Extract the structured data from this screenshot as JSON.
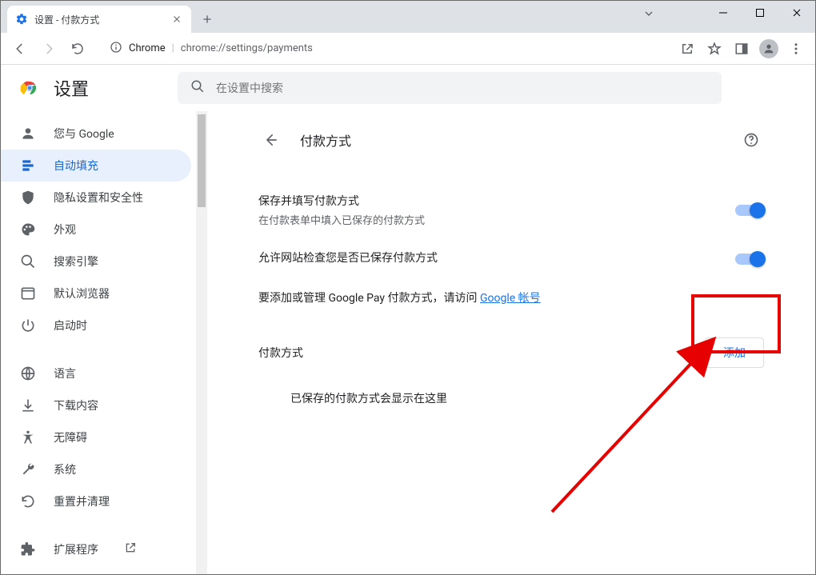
{
  "window": {
    "tab_title": "设置 - 付款方式",
    "url_site": "Chrome",
    "url_path": "chrome://settings/payments"
  },
  "settings": {
    "title": "设置",
    "search_placeholder": "在设置中搜索"
  },
  "sidebar": {
    "items": [
      {
        "key": "you",
        "label": "您与 Google",
        "icon": "person"
      },
      {
        "key": "autofill",
        "label": "自动填充",
        "icon": "autofill",
        "active": true
      },
      {
        "key": "privacy",
        "label": "隐私设置和安全性",
        "icon": "shield"
      },
      {
        "key": "appearance",
        "label": "外观",
        "icon": "palette"
      },
      {
        "key": "search",
        "label": "搜索引擎",
        "icon": "search"
      },
      {
        "key": "default",
        "label": "默认浏览器",
        "icon": "browser"
      },
      {
        "key": "startup",
        "label": "启动时",
        "icon": "power"
      }
    ],
    "items2": [
      {
        "key": "lang",
        "label": "语言",
        "icon": "globe"
      },
      {
        "key": "downloads",
        "label": "下载内容",
        "icon": "download"
      },
      {
        "key": "a11y",
        "label": "无障碍",
        "icon": "accessibility"
      },
      {
        "key": "system",
        "label": "系统",
        "icon": "wrench"
      },
      {
        "key": "reset",
        "label": "重置并清理",
        "icon": "reset"
      }
    ],
    "items3": [
      {
        "key": "ext",
        "label": "扩展程序",
        "icon": "extension",
        "external": true
      }
    ]
  },
  "page": {
    "title": "付款方式",
    "rows": [
      {
        "primary": "保存并填写付款方式",
        "secondary": "在付款表单中填入已保存的付款方式",
        "on": true
      },
      {
        "primary": "允许网站检查您是否已保存付款方式",
        "secondary": "",
        "on": true
      }
    ],
    "note_prefix": "要添加或管理 Google Pay 付款方式，请访问 ",
    "note_link": "Google 帐号",
    "section_title": "付款方式",
    "add_label": "添加",
    "empty": "已保存的付款方式会显示在这里"
  }
}
